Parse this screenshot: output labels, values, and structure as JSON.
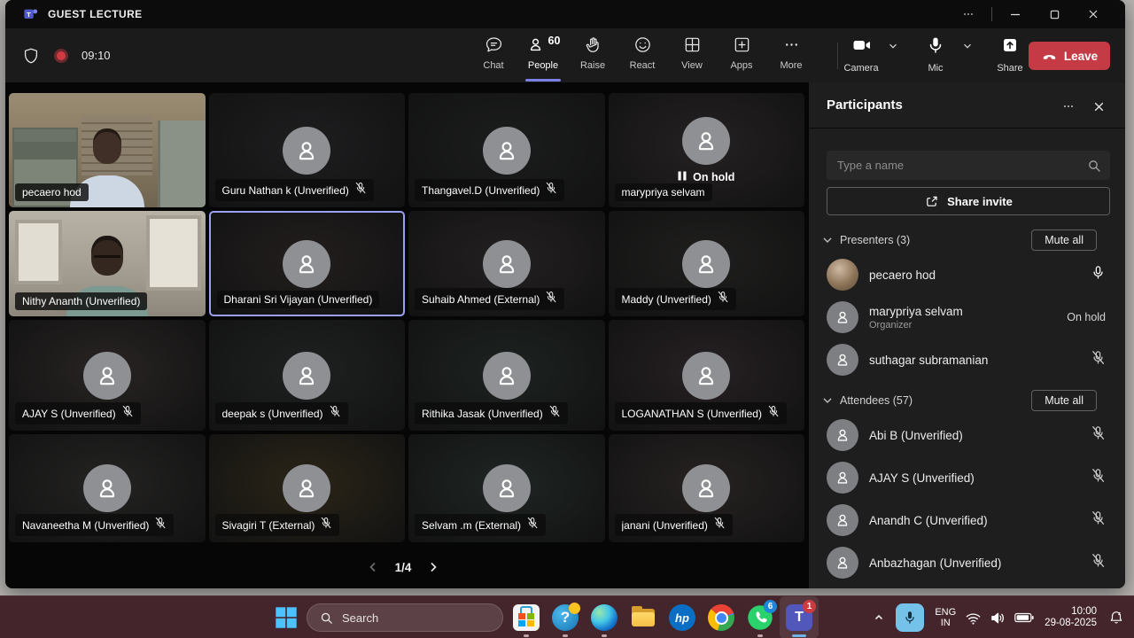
{
  "window": {
    "title": "GUEST LECTURE",
    "controls": {
      "more": "more",
      "minimize": "minimize",
      "maximize": "maximize",
      "close": "close"
    }
  },
  "colors": {
    "accent": "#7b81e3",
    "leave_red": "#c43b45",
    "selected_tile_border": "#9aa0f7",
    "record_red": "#cf3a40",
    "taskbar_bg": "#44252b",
    "badge_blue": "#1d86d8",
    "badge_red": "#cf3a3f",
    "tray_mic_bg": "#74c1ea",
    "desktop_gray": "#b5b2af"
  },
  "meeting_toolbar": {
    "timer": "09:10",
    "buttons": [
      {
        "id": "chat",
        "label": "Chat"
      },
      {
        "id": "people",
        "label": "People",
        "badge": "60",
        "active": true
      },
      {
        "id": "raise",
        "label": "Raise"
      },
      {
        "id": "react",
        "label": "React"
      },
      {
        "id": "view",
        "label": "View"
      },
      {
        "id": "apps",
        "label": "Apps"
      },
      {
        "id": "more",
        "label": "More"
      }
    ],
    "device_buttons": [
      {
        "id": "camera",
        "label": "Camera",
        "dropdown": true
      },
      {
        "id": "mic",
        "label": "Mic",
        "dropdown": true
      },
      {
        "id": "share",
        "label": "Share",
        "dropdown": false
      }
    ],
    "leave_label": "Leave"
  },
  "stage": {
    "tiles": [
      {
        "name": "pecaero hod",
        "type": "video",
        "scene": "office",
        "muted": false
      },
      {
        "name": "Guru Nathan k (Unverified)",
        "type": "avatar",
        "muted": true,
        "tint": "#1e1e20"
      },
      {
        "name": "Thangavel.D (Unverified)",
        "type": "avatar",
        "muted": true,
        "tint": "#1b1d1c"
      },
      {
        "name": "marypriya selvam",
        "type": "avatar",
        "muted": false,
        "status": "On hold",
        "tint": "#252122"
      },
      {
        "name": "Nithy Ananth (Unverified)",
        "type": "video",
        "scene": "home",
        "muted": false
      },
      {
        "name": "Dharani Sri Vijayan (Unverified)",
        "type": "avatar",
        "muted": false,
        "selected": true,
        "tint": "#231e1e"
      },
      {
        "name": "Suhaib Ahmed (External)",
        "type": "avatar",
        "muted": true,
        "tint": "#242021"
      },
      {
        "name": "Maddy (Unverified)",
        "type": "avatar",
        "muted": true,
        "tint": "#201f1e"
      },
      {
        "name": "AJAY S (Unverified)",
        "type": "avatar",
        "muted": true,
        "tint": "#282423"
      },
      {
        "name": "deepak s (Unverified)",
        "type": "avatar",
        "muted": true,
        "tint": "#1f2121"
      },
      {
        "name": "Rithika Jasak (Unverified)",
        "type": "avatar",
        "muted": true,
        "tint": "#1d2321"
      },
      {
        "name": "LOGANATHAN S (Unverified)",
        "type": "avatar",
        "muted": true,
        "tint": "#272124"
      },
      {
        "name": "Navaneetha M (Unverified)",
        "type": "avatar",
        "muted": true,
        "tint": "#242322"
      },
      {
        "name": "Sivagiri T (External)",
        "type": "avatar",
        "muted": true,
        "tint": "#2b2518"
      },
      {
        "name": "Selvam .m (External)",
        "type": "avatar",
        "muted": true,
        "tint": "#1f2624"
      },
      {
        "name": "janani (Unverified)",
        "type": "avatar",
        "muted": true,
        "tint": "#272222"
      }
    ],
    "pagination": {
      "current": "1/4",
      "prev_enabled": false,
      "next_enabled": true
    }
  },
  "participants_panel": {
    "title": "Participants",
    "search_placeholder": "Type a name",
    "share_invite_label": "Share invite",
    "sections": [
      {
        "label": "Presenters (3)",
        "mute_all_label": "Mute all",
        "members": [
          {
            "name": "pecaero hod",
            "avatar": "photo",
            "mic": "on"
          },
          {
            "name": "marypriya selvam",
            "subtitle": "Organizer",
            "status": "On hold"
          },
          {
            "name": "suthagar subramanian",
            "mic": "muted"
          }
        ]
      },
      {
        "label": "Attendees (57)",
        "mute_all_label": "Mute all",
        "members": [
          {
            "name": "Abi B (Unverified)",
            "mic": "muted"
          },
          {
            "name": "AJAY S (Unverified)",
            "mic": "muted"
          },
          {
            "name": "Anandh C (Unverified)",
            "mic": "muted"
          },
          {
            "name": "Anbazhagan (Unverified)",
            "mic": "muted"
          }
        ]
      }
    ]
  },
  "taskbar": {
    "search_label": "Search",
    "apps": [
      {
        "id": "store",
        "running": true
      },
      {
        "id": "help",
        "running": true
      },
      {
        "id": "edge",
        "running": true
      },
      {
        "id": "folder",
        "running": false
      },
      {
        "id": "hp",
        "running": false
      },
      {
        "id": "chrome",
        "running": false
      },
      {
        "id": "whatsapp",
        "running": true,
        "badge": "6",
        "badge_color": "blue"
      },
      {
        "id": "teams",
        "running": true,
        "badge": "1",
        "badge_color": "red",
        "active": true
      }
    ],
    "tray": {
      "language": "ENG",
      "region": "IN",
      "time": "10:00",
      "date": "29-08-2025"
    }
  }
}
